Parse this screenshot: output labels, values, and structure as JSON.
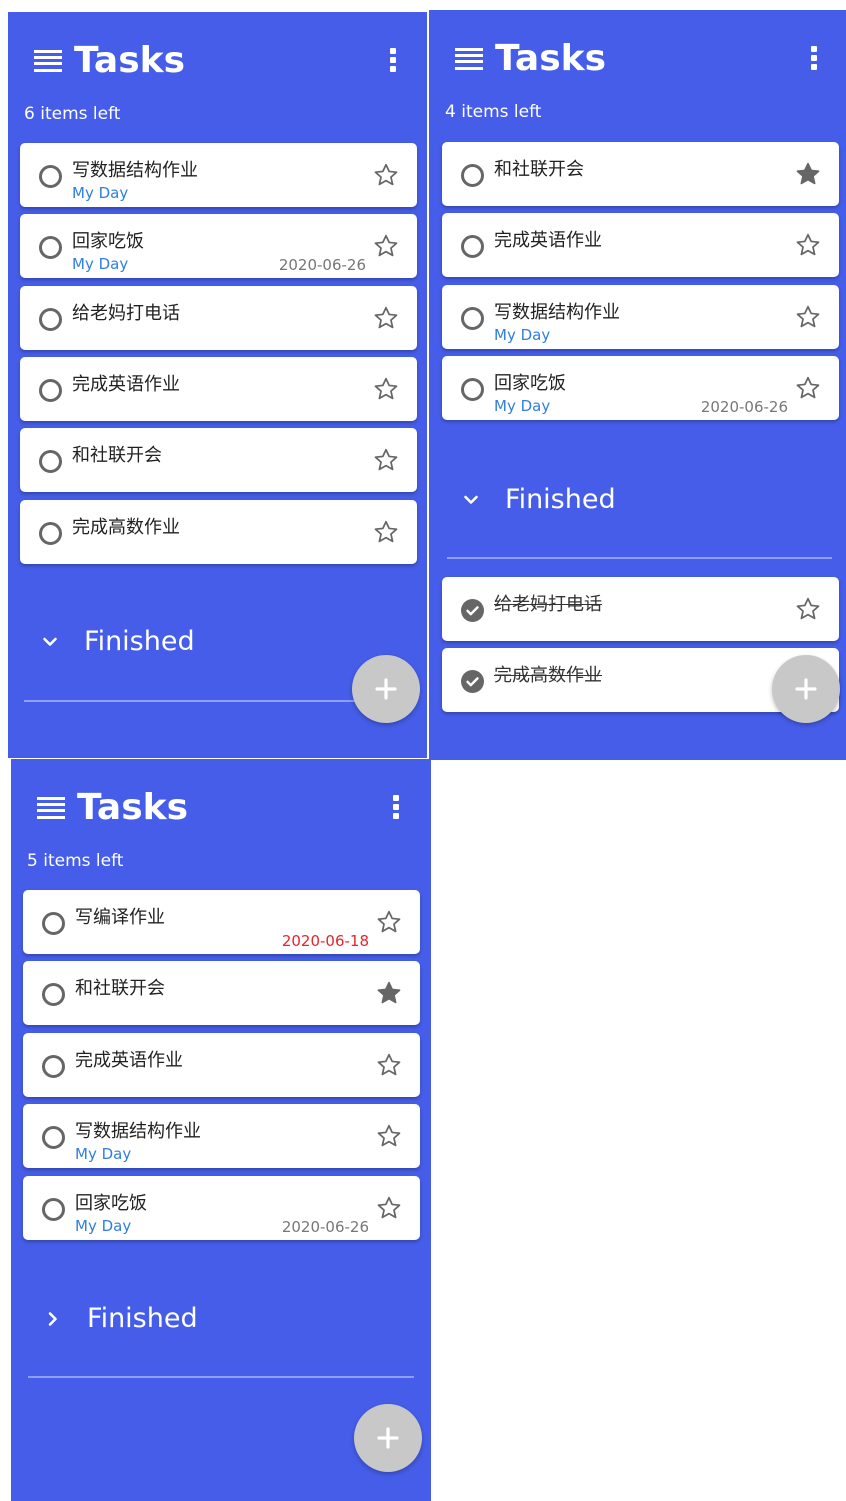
{
  "screens": [
    {
      "title": "Tasks",
      "items_left": "6 items left",
      "tasks": [
        {
          "title": "写数据结构作业",
          "my_day": "My Day",
          "date": "",
          "starred": false
        },
        {
          "title": "回家吃饭",
          "my_day": "My Day",
          "date": "2020-06-26",
          "starred": false
        },
        {
          "title": "给老妈打电话",
          "my_day": "",
          "date": "",
          "starred": false
        },
        {
          "title": "完成英语作业",
          "my_day": "",
          "date": "",
          "starred": false
        },
        {
          "title": "和社联开会",
          "my_day": "",
          "date": "",
          "starred": false
        },
        {
          "title": "完成高数作业",
          "my_day": "",
          "date": "",
          "starred": false
        }
      ],
      "finished": {
        "label": "Finished",
        "expanded": true,
        "tasks": []
      }
    },
    {
      "title": "Tasks",
      "items_left": "4 items left",
      "tasks": [
        {
          "title": "和社联开会",
          "my_day": "",
          "date": "",
          "starred": true
        },
        {
          "title": "完成英语作业",
          "my_day": "",
          "date": "",
          "starred": false
        },
        {
          "title": "写数据结构作业",
          "my_day": "My Day",
          "date": "",
          "starred": false
        },
        {
          "title": "回家吃饭",
          "my_day": "My Day",
          "date": "2020-06-26",
          "starred": false
        }
      ],
      "finished": {
        "label": "Finished",
        "expanded": true,
        "tasks": [
          {
            "title": "给老妈打电话",
            "starred": false
          },
          {
            "title": "完成高数作业",
            "starred": false
          }
        ]
      }
    },
    {
      "title": "Tasks",
      "items_left": "5 items left",
      "tasks": [
        {
          "title": "写编译作业",
          "my_day": "",
          "date": "2020-06-18",
          "overdue": true,
          "starred": false
        },
        {
          "title": "和社联开会",
          "my_day": "",
          "date": "",
          "starred": true
        },
        {
          "title": "完成英语作业",
          "my_day": "",
          "date": "",
          "starred": false
        },
        {
          "title": "写数据结构作业",
          "my_day": "My Day",
          "date": "",
          "starred": false
        },
        {
          "title": "回家吃饭",
          "my_day": "My Day",
          "date": "2020-06-26",
          "starred": false
        }
      ],
      "finished": {
        "label": "Finished",
        "expanded": false,
        "tasks": []
      }
    }
  ],
  "colors": {
    "background": "#455de8",
    "card": "#ffffff",
    "my_day": "#2f7fe0",
    "overdue_date": "#e6242b",
    "date": "#777777",
    "icon": "#666666",
    "fab": "#c8c8c8"
  },
  "icons": {
    "menu": "menu-lines-icon",
    "more": "more-vertical-icon",
    "star_empty": "star-outline-icon",
    "star_filled": "star-filled-icon",
    "checkbox_empty": "circle-outline-icon",
    "checkbox_done": "check-circle-icon",
    "section_expanded": "chevron-down-icon",
    "section_collapsed": "chevron-right-icon",
    "add": "plus-icon"
  }
}
